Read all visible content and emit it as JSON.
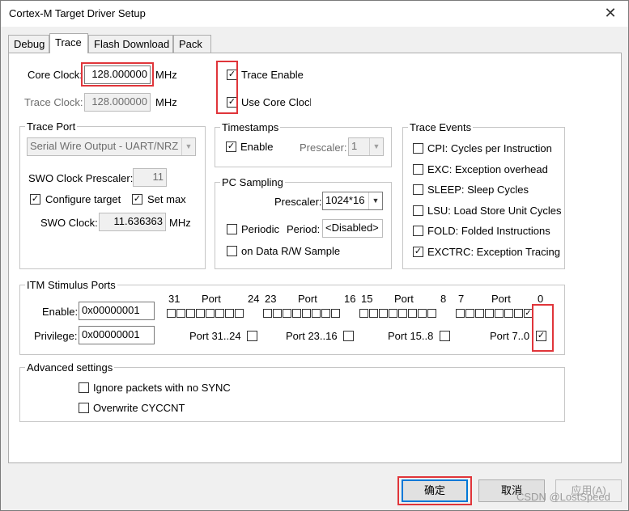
{
  "window": {
    "title": "Cortex-M Target Driver Setup",
    "close_glyph": "✕"
  },
  "tabs": [
    {
      "label": "Debug"
    },
    {
      "label": "Trace"
    },
    {
      "label": "Flash Download"
    },
    {
      "label": "Pack"
    }
  ],
  "core_clock": {
    "label": "Core Clock:",
    "value": "128.000000",
    "unit": "MHz"
  },
  "trace_clock": {
    "label": "Trace Clock:",
    "value": "128.000000",
    "unit": "MHz"
  },
  "trace_enable": {
    "label": "Trace Enable",
    "checked": true
  },
  "use_core_clock": {
    "label": "Use Core Clock",
    "checked": true
  },
  "trace_port": {
    "title": "Trace Port",
    "mode": "Serial Wire Output - UART/NRZ",
    "swo_prescaler_label": "SWO Clock Prescaler:",
    "swo_prescaler_value": "11",
    "configure_target_label": "Configure target",
    "set_max_label": "Set max",
    "swo_clock_label": "SWO Clock:",
    "swo_clock_value": "11.636363",
    "swo_clock_unit": "MHz"
  },
  "timestamps": {
    "title": "Timestamps",
    "enable_label": "Enable",
    "prescaler_label": "Prescaler:",
    "prescaler_value": "1"
  },
  "pc_sampling": {
    "title": "PC Sampling",
    "prescaler_label": "Prescaler:",
    "prescaler_value": "1024*16",
    "periodic_label": "Periodic",
    "period_label": "Period:",
    "period_value": "<Disabled>",
    "data_rw_label": "on Data R/W Sample"
  },
  "trace_events": {
    "title": "Trace Events",
    "items": [
      {
        "label": "CPI: Cycles per Instruction",
        "checked": false
      },
      {
        "label": "EXC: Exception overhead",
        "checked": false
      },
      {
        "label": "SLEEP: Sleep Cycles",
        "checked": false
      },
      {
        "label": "LSU: Load Store Unit Cycles",
        "checked": false
      },
      {
        "label": "FOLD: Folded Instructions",
        "checked": false
      },
      {
        "label": "EXCTRC: Exception Tracing",
        "checked": true
      }
    ]
  },
  "itm": {
    "title": "ITM Stimulus Ports",
    "enable_label": "Enable:",
    "enable_value": "0x00000001",
    "privilege_label": "Privilege:",
    "privilege_value": "0x00000001",
    "header": {
      "n31": "31",
      "port_a": "Port",
      "n24": "24",
      "n23": "23",
      "port_b": "Port",
      "n16": "16",
      "n15": "15",
      "port_c": "Port",
      "n8": "8",
      "n7": "7",
      "port_d": "Port",
      "n0": "0"
    },
    "priv_groups": [
      "Port 31..24",
      "Port 23..16",
      "Port 15..8",
      "Port 7..0"
    ]
  },
  "advanced": {
    "title": "Advanced settings",
    "ignore_sync_label": "Ignore packets with no SYNC",
    "overwrite_cyccnt_label": "Overwrite CYCCNT"
  },
  "buttons": {
    "ok": "确定",
    "cancel": "取消",
    "apply": "应用(A)"
  },
  "watermark": "CSDN @LostSpeed",
  "check_glyph": "✓",
  "arrow_glyph": "▼",
  "highlight_color": "#e0353a"
}
